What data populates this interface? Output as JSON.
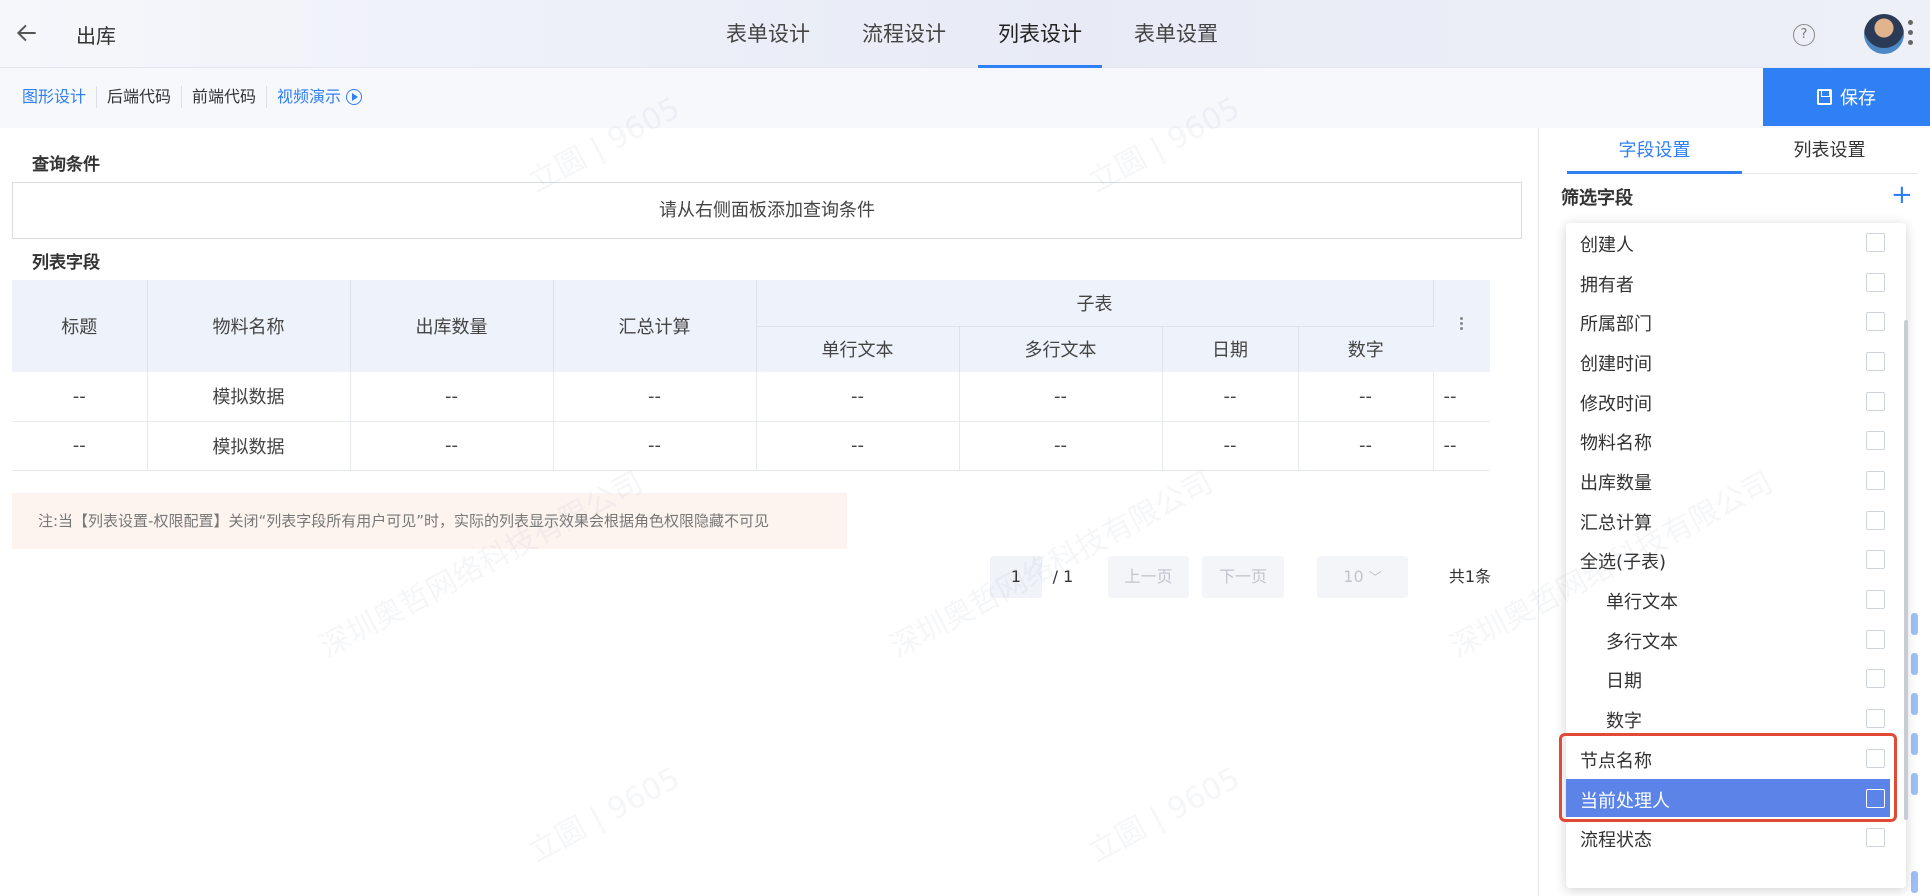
{
  "header": {
    "title": "出库",
    "tabs": [
      {
        "label": "表单设计"
      },
      {
        "label": "流程设计"
      },
      {
        "label": "列表设计",
        "active": true
      },
      {
        "label": "表单设置"
      }
    ],
    "help_glyph": "?"
  },
  "toolbar": {
    "links": [
      "图形设计",
      "后端代码",
      "前端代码"
    ],
    "video_label": "视频演示",
    "save_label": "保存"
  },
  "main": {
    "query_title": "查询条件",
    "query_placeholder": "请从右侧面板添加查询条件",
    "list_title": "列表字段",
    "table": {
      "columns": [
        "标题",
        "物料名称",
        "出库数量",
        "汇总计算"
      ],
      "group_header": "子表",
      "sub_columns": [
        "单行文本",
        "多行文本",
        "日期",
        "数字"
      ],
      "rows": [
        [
          "--",
          "模拟数据",
          "--",
          "--",
          "--",
          "--",
          "--",
          "--",
          "--"
        ],
        [
          "--",
          "模拟数据",
          "--",
          "--",
          "--",
          "--",
          "--",
          "--",
          "--"
        ]
      ]
    },
    "note": "注:当【列表设置-权限配置】关闭“列表字段所有用户可见”时，实际的列表显示效果会根据角色权限隐藏不可见",
    "pager": {
      "current": "1",
      "total_pages": "/ 1",
      "prev": "上一页",
      "next": "下一页",
      "page_size": "10",
      "total": "共1条"
    }
  },
  "right_panel": {
    "tabs": [
      "字段设置",
      "列表设置"
    ],
    "filter_title": "筛选字段",
    "dropdown_items": [
      {
        "label": "创建人",
        "indent": false,
        "highlighted": false
      },
      {
        "label": "拥有者",
        "indent": false,
        "highlighted": false
      },
      {
        "label": "所属部门",
        "indent": false,
        "highlighted": false
      },
      {
        "label": "创建时间",
        "indent": false,
        "highlighted": false
      },
      {
        "label": "修改时间",
        "indent": false,
        "highlighted": false
      },
      {
        "label": "物料名称",
        "indent": false,
        "highlighted": false
      },
      {
        "label": "出库数量",
        "indent": false,
        "highlighted": false
      },
      {
        "label": "汇总计算",
        "indent": false,
        "highlighted": false
      },
      {
        "label": "全选(子表)",
        "indent": false,
        "highlighted": false
      },
      {
        "label": "单行文本",
        "indent": true,
        "highlighted": false
      },
      {
        "label": "多行文本",
        "indent": true,
        "highlighted": false
      },
      {
        "label": "日期",
        "indent": true,
        "highlighted": false
      },
      {
        "label": "数字",
        "indent": true,
        "highlighted": false
      },
      {
        "label": "节点名称",
        "indent": false,
        "highlighted": false
      },
      {
        "label": "当前处理人",
        "indent": false,
        "highlighted": true
      },
      {
        "label": "流程状态",
        "indent": false,
        "highlighted": false
      }
    ]
  },
  "watermark": [
    "立圆 | 9605",
    "深圳奥哲网络科技有限公司"
  ],
  "colors": {
    "accent": "#2f7ff5",
    "highlight_row": "#5b83e8",
    "outline": "#e14a35"
  }
}
